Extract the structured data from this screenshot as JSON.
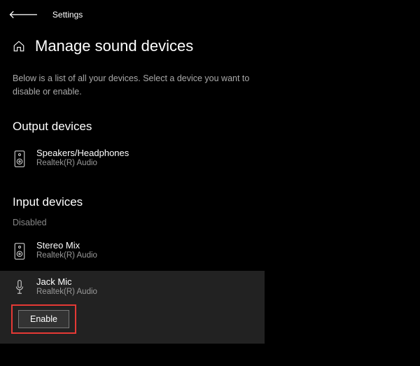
{
  "header": {
    "app_title": "Settings",
    "page_title": "Manage sound devices",
    "description": "Below is a list of all your devices. Select a device you want to disable or enable."
  },
  "output": {
    "section_label": "Output devices",
    "devices": [
      {
        "name": "Speakers/Headphones",
        "sub": "Realtek(R) Audio"
      }
    ]
  },
  "input": {
    "section_label": "Input devices",
    "disabled_label": "Disabled",
    "devices": [
      {
        "name": "Stereo Mix",
        "sub": "Realtek(R) Audio"
      },
      {
        "name": "Jack Mic",
        "sub": "Realtek(R) Audio"
      }
    ],
    "enable_label": "Enable"
  }
}
